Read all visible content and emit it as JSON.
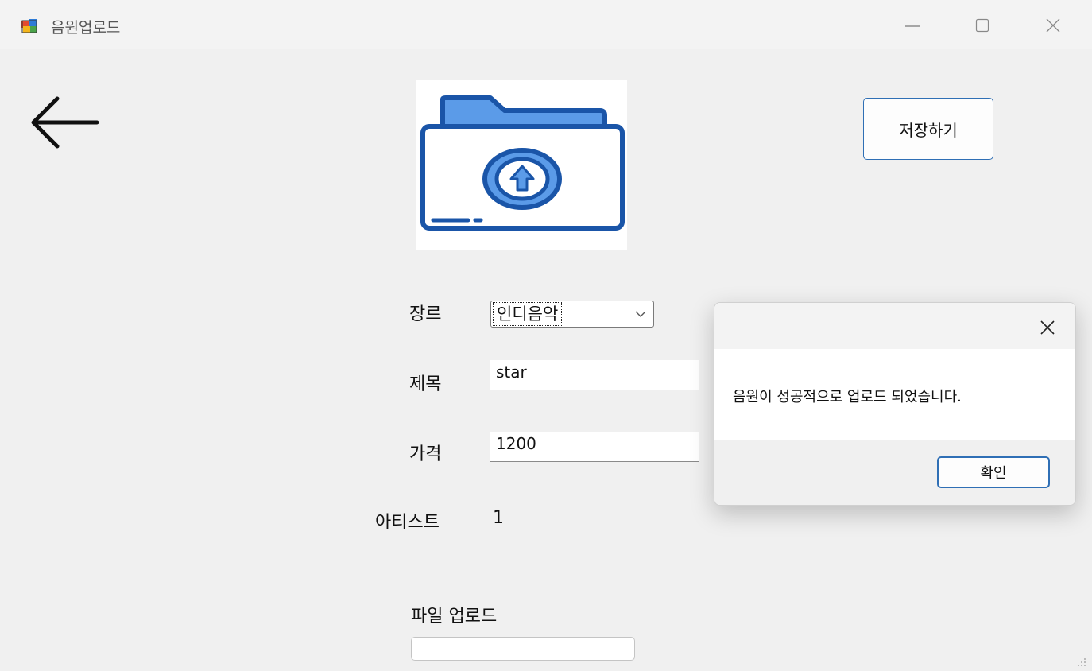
{
  "window": {
    "title": "음원업로드",
    "controls": [
      "minimize",
      "maximize",
      "close"
    ]
  },
  "toolbar": {
    "back_icon": "arrow-left-icon",
    "save_label": "저장하기"
  },
  "illustration": {
    "icon": "folder-upload-icon",
    "colors": {
      "dark_blue": "#1a55a8",
      "light_blue": "#5b9be8"
    }
  },
  "form": {
    "genre_label": "장르",
    "genre_value": "인디음악",
    "title_label": "제목",
    "title_value": "star",
    "price_label": "가격",
    "price_value": "1200",
    "artist_label": "아티스트",
    "artist_value": "1",
    "file_label": "파일 업로드",
    "file_value": ""
  },
  "dialog": {
    "message": "음원이 성공적으로 업로드 되었습니다.",
    "ok_label": "확인",
    "accent": "#2f6fb5"
  }
}
